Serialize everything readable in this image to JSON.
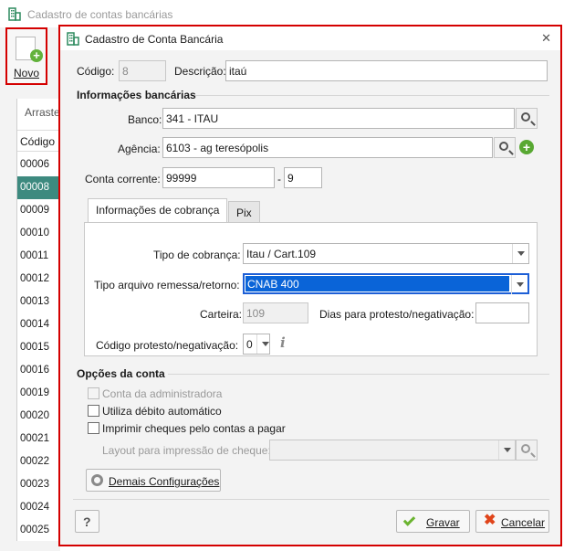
{
  "background_window": {
    "title": "Cadastro de contas bancárias",
    "novo_label": "Novo",
    "list_header_1": "Arraste",
    "list_header_2": "Código",
    "rows": [
      "00006",
      "00008",
      "00009",
      "00010",
      "00011",
      "00012",
      "00013",
      "00014",
      "00015",
      "00016",
      "00019",
      "00020",
      "00021",
      "00022",
      "00023",
      "00024",
      "00025"
    ],
    "selected_row": "00008"
  },
  "dialog": {
    "title": "Cadastro de Conta Bancária",
    "close_glyph": "✕",
    "codigo_label": "Código:",
    "codigo_value": "8",
    "descricao_label": "Descrição:",
    "descricao_value": "itaú",
    "info_section": "Informações bancárias",
    "banco_label": "Banco:",
    "banco_value": "341 - ITAU",
    "agencia_label": "Agência:",
    "agencia_value": "6103 - ag teresópolis",
    "conta_label": "Conta corrente:",
    "conta_value": "99999",
    "conta_sep": "-",
    "conta_digito": "9",
    "tabs": [
      "Informações de cobrança",
      "Pix"
    ],
    "tipo_cobranca_label": "Tipo de cobrança:",
    "tipo_cobranca_value": "Itau / Cart.109",
    "tipo_arquivo_label": "Tipo arquivo remessa/retorno:",
    "tipo_arquivo_value": "CNAB 400",
    "carteira_label": "Carteira:",
    "carteira_value": "109",
    "dias_label": "Dias para protesto/negativação:",
    "dias_value": "",
    "codigo_protesto_label": "Código protesto/negativação:",
    "codigo_protesto_value": "0",
    "info_glyph": "i",
    "opcoes_section": "Opções da conta",
    "chk_admin": "Conta da administradora",
    "chk_debito": "Utiliza débito automático",
    "chk_cheques": "Imprimir cheques pelo contas a pagar",
    "layout_label": "Layout para impressão de cheque:",
    "layout_value": "",
    "demais_btn": "Demais Configurações",
    "help_btn": "?",
    "gravar_btn": "Gravar",
    "cancelar_btn": "Cancelar"
  },
  "colors": {
    "highlight_border": "#d40000",
    "selection_blue": "#0a64d8",
    "selected_row": "#3d8a7f",
    "add_green": "#58a832"
  }
}
